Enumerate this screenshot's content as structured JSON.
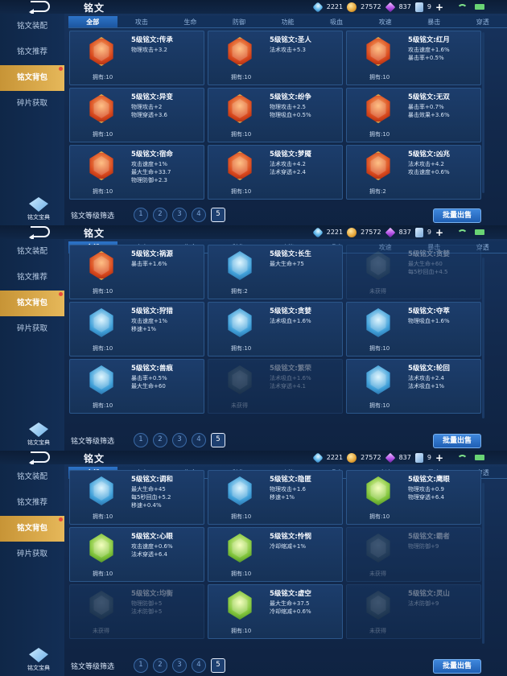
{
  "header": {
    "title": "铭文",
    "back_icon": "back-arrow-icon"
  },
  "stats": {
    "diamonds": "2221",
    "gold": "27572",
    "gems": "837",
    "tickets": "9"
  },
  "tabs": [
    "全部",
    "攻击",
    "生命",
    "防御",
    "功能",
    "吸血",
    "攻速",
    "暴击",
    "穿透"
  ],
  "sidebar": {
    "items": [
      "铭文装配",
      "铭文推荐",
      "铭文背包",
      "碎片获取"
    ],
    "active_index": 2,
    "dict_label": "铭文宝典"
  },
  "filter": {
    "label": "铭文等级筛选",
    "levels": [
      "1",
      "2",
      "3",
      "4",
      "5"
    ],
    "active_level": "5"
  },
  "sell_label": "批量出售",
  "panels": [
    {
      "cards": [
        {
          "name": "5级铭文:传承",
          "attrs": [
            "物理攻击+3.2"
          ],
          "owned": "拥有:10",
          "color": "red",
          "locked": false
        },
        {
          "name": "5级铭文:圣人",
          "attrs": [
            "法术攻击+5.3"
          ],
          "owned": "拥有:10",
          "color": "red",
          "locked": false
        },
        {
          "name": "5级铭文:红月",
          "attrs": [
            "攻击速度+1.6%",
            "暴击率+0.5%"
          ],
          "owned": "拥有:10",
          "color": "red",
          "locked": false
        },
        {
          "name": "5级铭文:异变",
          "attrs": [
            "物理攻击+2",
            "物理穿透+3.6"
          ],
          "owned": "拥有:10",
          "color": "red",
          "locked": false
        },
        {
          "name": "5级铭文:纷争",
          "attrs": [
            "物理攻击+2.5",
            "物理吸血+0.5%"
          ],
          "owned": "拥有:10",
          "color": "red",
          "locked": false
        },
        {
          "name": "5级铭文:无双",
          "attrs": [
            "暴击率+0.7%",
            "暴击效果+3.6%"
          ],
          "owned": "拥有:10",
          "color": "red",
          "locked": false
        },
        {
          "name": "5级铭文:宿命",
          "attrs": [
            "攻击速度+1%",
            "最大生命+33.7",
            "物理防御+2.3"
          ],
          "owned": "拥有:10",
          "color": "red",
          "locked": false
        },
        {
          "name": "5级铭文:梦魇",
          "attrs": [
            "法术攻击+4.2",
            "法术穿透+2.4"
          ],
          "owned": "拥有:10",
          "color": "red",
          "locked": false
        },
        {
          "name": "5级铭文:凶兆",
          "attrs": [
            "法术攻击+4.2",
            "攻击速度+0.6%"
          ],
          "owned": "拥有:2",
          "color": "red",
          "locked": false
        }
      ]
    },
    {
      "cards": [
        {
          "name": "5级铭文:祸源",
          "attrs": [
            "暴击率+1.6%"
          ],
          "owned": "拥有:10",
          "color": "red",
          "locked": false
        },
        {
          "name": "5级铭文:长生",
          "attrs": [
            "最大生命+75"
          ],
          "owned": "拥有:2",
          "color": "blue",
          "locked": false
        },
        {
          "name": "5级铭文:贪婪",
          "attrs": [
            "最大生命+60",
            "每5秒回血+4.5"
          ],
          "owned": "未获得",
          "color": "dark",
          "locked": true
        },
        {
          "name": "5级铭文:狩猎",
          "attrs": [
            "攻击速度+1%",
            "移速+1%"
          ],
          "owned": "拥有:10",
          "color": "blue",
          "locked": false
        },
        {
          "name": "5级铭文:贪婪",
          "attrs": [
            "法术吸血+1.6%"
          ],
          "owned": "拥有:10",
          "color": "blue",
          "locked": false
        },
        {
          "name": "5级铭文:夺萃",
          "attrs": [
            "物理吸血+1.6%"
          ],
          "owned": "拥有:10",
          "color": "blue",
          "locked": false
        },
        {
          "name": "5级铭文:兽痕",
          "attrs": [
            "暴击率+0.5%",
            "最大生命+60"
          ],
          "owned": "拥有:10",
          "color": "blue",
          "locked": false
        },
        {
          "name": "5级铭文:繁荣",
          "attrs": [
            "法术吸血+1.6%",
            "法术穿透+4.1"
          ],
          "owned": "未获得",
          "color": "dark",
          "locked": true
        },
        {
          "name": "5级铭文:轮回",
          "attrs": [
            "法术攻击+2.4",
            "法术吸血+1%"
          ],
          "owned": "拥有:10",
          "color": "blue",
          "locked": false
        }
      ]
    },
    {
      "cards": [
        {
          "name": "5级铭文:调和",
          "attrs": [
            "最大生命+45",
            "每5秒回血+5.2",
            "移速+0.4%"
          ],
          "owned": "拥有:10",
          "color": "blue",
          "locked": false
        },
        {
          "name": "5级铭文:隐匿",
          "attrs": [
            "物理攻击+1.6",
            "移速+1%"
          ],
          "owned": "拥有:10",
          "color": "blue",
          "locked": false
        },
        {
          "name": "5级铭文:鹰眼",
          "attrs": [
            "物理攻击+0.9",
            "物理穿透+6.4"
          ],
          "owned": "拥有:10",
          "color": "green",
          "locked": false
        },
        {
          "name": "5级铭文:心眼",
          "attrs": [
            "攻击速度+0.6%",
            "法术穿透+6.4"
          ],
          "owned": "拥有:10",
          "color": "green",
          "locked": false
        },
        {
          "name": "5级铭文:怜悯",
          "attrs": [
            "冷却缩减+1%"
          ],
          "owned": "拥有:10",
          "color": "green",
          "locked": false
        },
        {
          "name": "5级铭文:霸者",
          "attrs": [
            "物理防御+9"
          ],
          "owned": "未获得",
          "color": "dark",
          "locked": true
        },
        {
          "name": "5级铭文:均衡",
          "attrs": [
            "物理防御+5",
            "法术防御+5"
          ],
          "owned": "未获得",
          "color": "dark",
          "locked": true
        },
        {
          "name": "5级铭文:虚空",
          "attrs": [
            "最大生命+37.5",
            "冷却缩减+0.6%"
          ],
          "owned": "拥有:10",
          "color": "green",
          "locked": false
        },
        {
          "name": "5级铭文:灵山",
          "attrs": [
            "法术防御+9"
          ],
          "owned": "未获得",
          "color": "dark",
          "locked": true
        }
      ]
    }
  ]
}
